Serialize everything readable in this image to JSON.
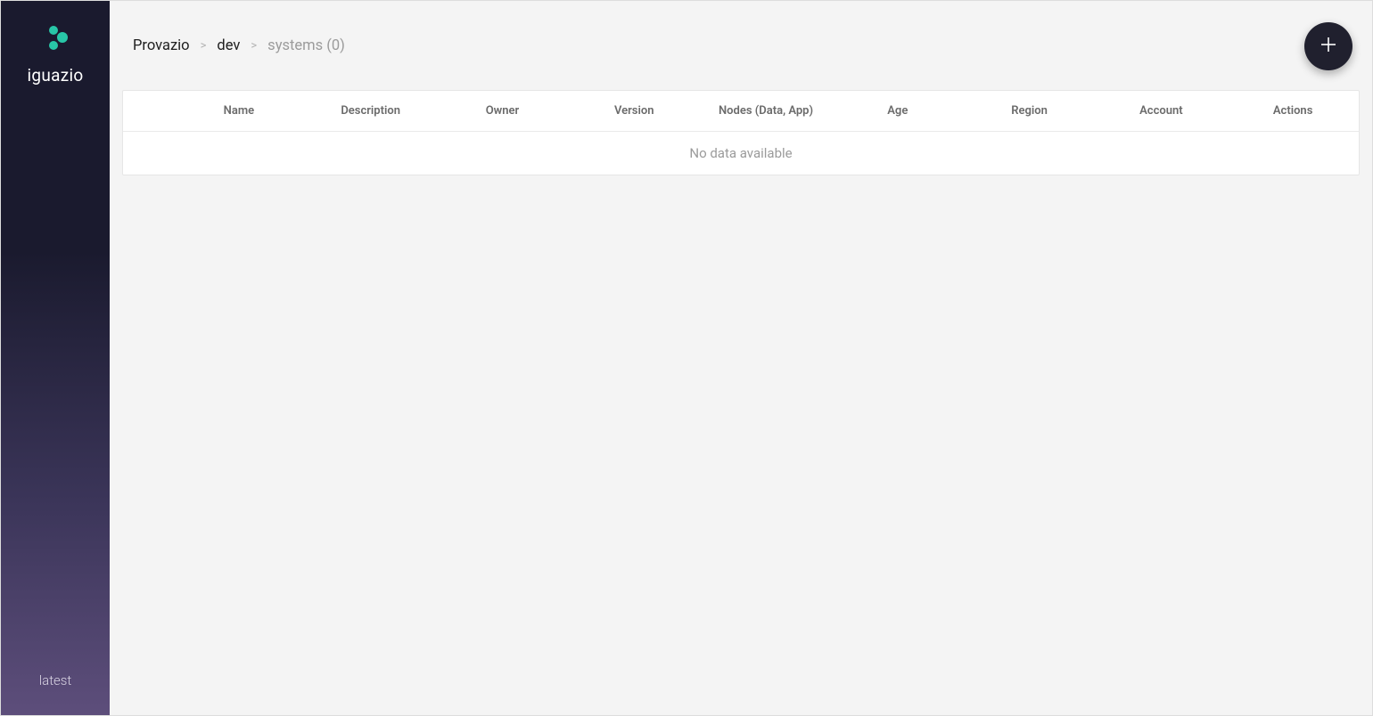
{
  "sidebar": {
    "brand_name": "iguazio",
    "version_label": "latest"
  },
  "breadcrumb": {
    "items": [
      {
        "label": "Provazio",
        "link": true,
        "muted": false
      },
      {
        "label": "dev",
        "link": true,
        "muted": false
      },
      {
        "label": "systems (0)",
        "link": false,
        "muted": true
      }
    ],
    "separator": ">"
  },
  "table": {
    "columns": [
      "Name",
      "Description",
      "Owner",
      "Version",
      "Nodes (Data, App)",
      "Age",
      "Region",
      "Account",
      "Actions"
    ],
    "empty_message": "No data available"
  },
  "colors": {
    "accent": "#28c6a7",
    "fab_bg": "#20202e"
  }
}
